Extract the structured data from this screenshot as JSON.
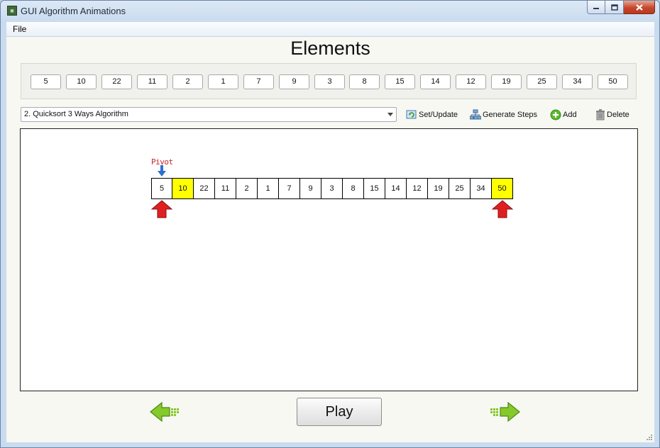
{
  "window": {
    "title": "GUI Algorithm Animations",
    "icon": "app-icon"
  },
  "menu": {
    "file": "File"
  },
  "heading": "Elements",
  "elements": [
    "5",
    "10",
    "22",
    "11",
    "2",
    "1",
    "7",
    "9",
    "3",
    "8",
    "15",
    "14",
    "12",
    "19",
    "25",
    "34",
    "50"
  ],
  "toolbar": {
    "algorithm": "2. Quicksort 3 Ways Algorithm",
    "set_update": "Set/Update",
    "generate_steps": "Generate Steps",
    "add": "Add",
    "delete": "Delete"
  },
  "visualization": {
    "pivot_label": "Pivot",
    "array": [
      "5",
      "10",
      "22",
      "11",
      "2",
      "1",
      "7",
      "9",
      "3",
      "8",
      "15",
      "14",
      "12",
      "19",
      "25",
      "34",
      "50"
    ],
    "highlighted_indices": [
      1,
      16
    ],
    "pivot_index": 0,
    "pointer_indices": [
      0,
      16
    ],
    "colors": {
      "highlight": "#ffff00",
      "pointer": "#e02020",
      "pivot_marker": "#2f6fd0"
    }
  },
  "controls": {
    "play": "Play",
    "prev_icon": "left-arrow-icon",
    "next_icon": "right-arrow-icon"
  }
}
